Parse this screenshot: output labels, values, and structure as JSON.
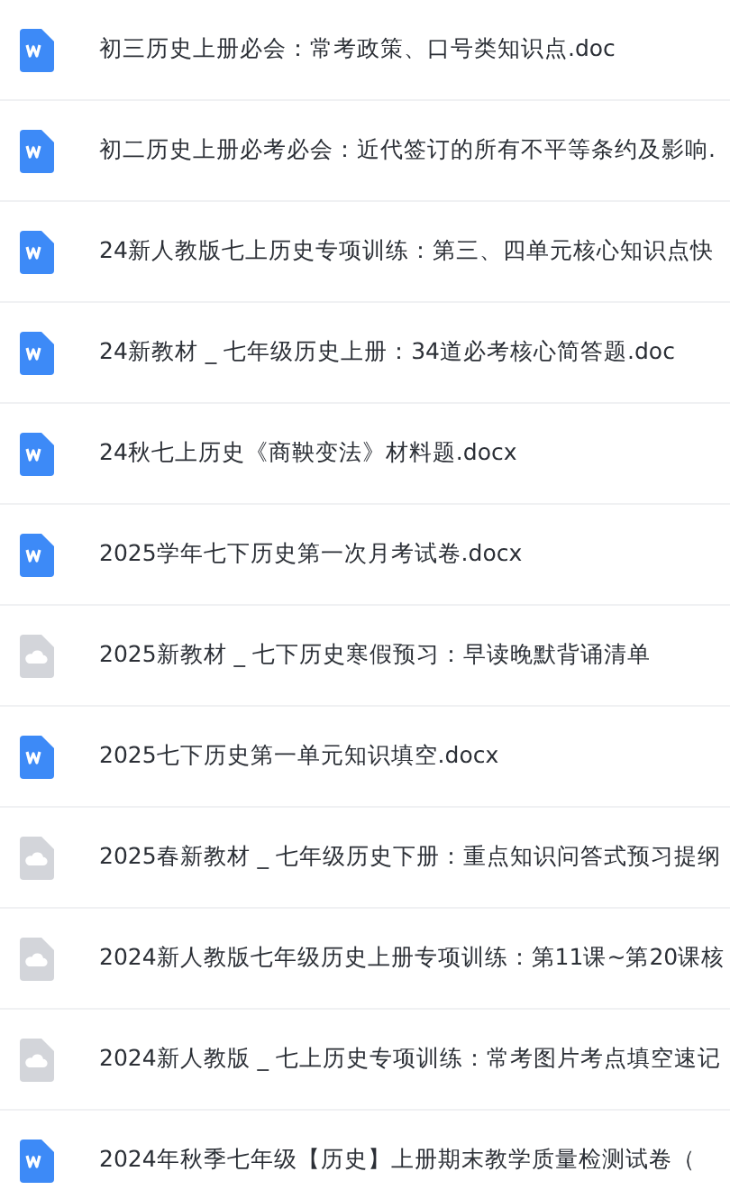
{
  "files": [
    {
      "kind": "word",
      "name": "初三历史上册必会：常考政策、口号类知识点.doc"
    },
    {
      "kind": "word",
      "name": "初二历史上册必考必会：近代签订的所有不平等条约及影响."
    },
    {
      "kind": "word",
      "name": "24新人教版七上历史专项训练：第三、四单元核心知识点快"
    },
    {
      "kind": "word",
      "name": "24新教材 _ 七年级历史上册：34道必考核心简答题.doc"
    },
    {
      "kind": "word",
      "name": "24秋七上历史《商鞅变法》材料题.docx"
    },
    {
      "kind": "word",
      "name": "2025学年七下历史第一次月考试卷.docx"
    },
    {
      "kind": "cloud",
      "name": "2025新教材 _ 七下历史寒假预习：早读晚默背诵清单"
    },
    {
      "kind": "word",
      "name": "2025七下历史第一单元知识填空.docx"
    },
    {
      "kind": "cloud",
      "name": "2025春新教材 _ 七年级历史下册：重点知识问答式预习提纲"
    },
    {
      "kind": "cloud",
      "name": "2024新人教版七年级历史上册专项训练：第11课~第20课核"
    },
    {
      "kind": "cloud",
      "name": "2024新人教版 _ 七上历史专项训练：常考图片考点填空速记"
    },
    {
      "kind": "word",
      "name": "2024年秋季七年级【历史】上册期末教学质量检测试卷（"
    }
  ]
}
